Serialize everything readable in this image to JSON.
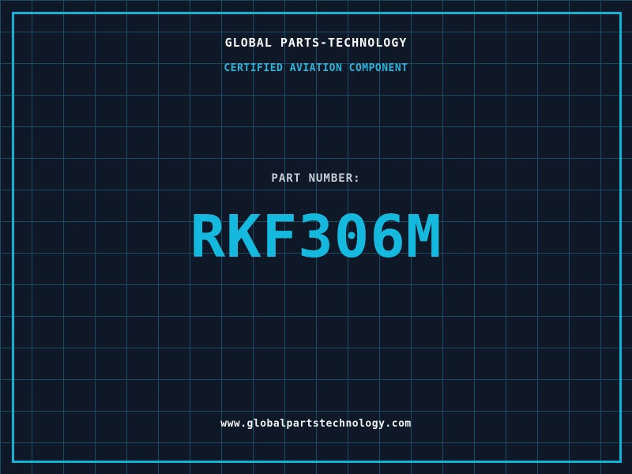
{
  "header": {
    "title": "GLOBAL PARTS-TECHNOLOGY",
    "subtitle": "CERTIFIED AVIATION COMPONENT"
  },
  "part": {
    "label": "PART NUMBER:",
    "number": "RKF306M"
  },
  "footer": {
    "url": "www.globalpartstechnology.com"
  },
  "colors": {
    "background": "#0e1826",
    "grid_line": "#1d4a5e",
    "frame_cyan": "#12b2d8",
    "part_number_cyan": "#14b9dd",
    "subtitle_cyan": "#2bb3d8",
    "title_white": "#f7f9fb",
    "label_gray": "#c6ccd6",
    "url_white": "#eef1f5"
  }
}
